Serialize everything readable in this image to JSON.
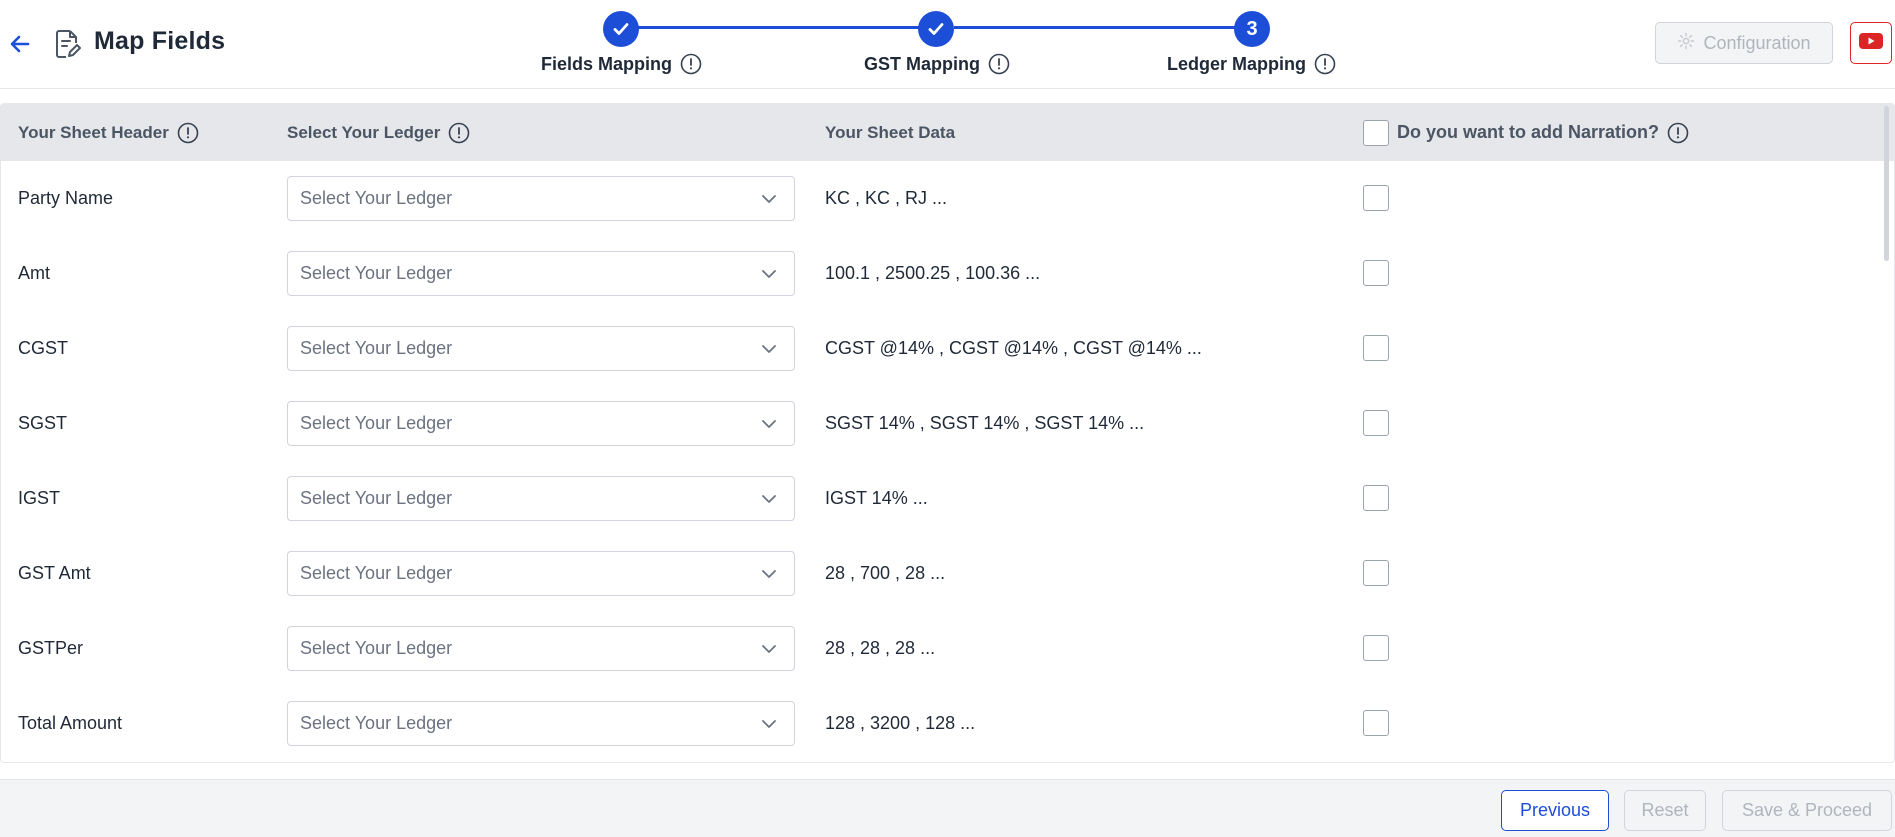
{
  "header": {
    "title": "Map Fields",
    "configuration_label": "Configuration"
  },
  "stepper": {
    "steps": [
      {
        "label": "Fields Mapping",
        "state": "completed",
        "marker": ""
      },
      {
        "label": "GST Mapping",
        "state": "completed",
        "marker": ""
      },
      {
        "label": "Ledger Mapping",
        "state": "active",
        "marker": "3"
      }
    ]
  },
  "table": {
    "columns": {
      "sheet_header": "Your Sheet Header",
      "select_ledger": "Select Your Ledger",
      "sheet_data": "Your Sheet Data",
      "narration": "Do you want to add Narration?"
    },
    "rows": [
      {
        "name": "Party Name",
        "select_placeholder": "Select Your Ledger",
        "data": "KC , KC , RJ ..."
      },
      {
        "name": "Amt",
        "select_placeholder": "Select Your Ledger",
        "data": "100.1 , 2500.25 , 100.36 ..."
      },
      {
        "name": "CGST",
        "select_placeholder": "Select Your Ledger",
        "data": "CGST @14% , CGST @14% , CGST @14% ..."
      },
      {
        "name": "SGST",
        "select_placeholder": "Select Your Ledger",
        "data": "SGST 14% , SGST 14% , SGST 14% ..."
      },
      {
        "name": "IGST",
        "select_placeholder": "Select Your Ledger",
        "data": "IGST 14% ..."
      },
      {
        "name": "GST Amt",
        "select_placeholder": "Select Your Ledger",
        "data": "28 , 700 , 28 ..."
      },
      {
        "name": "GSTPer",
        "select_placeholder": "Select Your Ledger",
        "data": "28 , 28 , 28 ..."
      },
      {
        "name": "Total Amount",
        "select_placeholder": "Select Your Ledger",
        "data": "128 , 3200 , 128 ..."
      }
    ]
  },
  "footer": {
    "previous_label": "Previous",
    "reset_label": "Reset",
    "save_label": "Save & Proceed"
  },
  "colors": {
    "primary": "#1d4ed8",
    "youtube_red": "#dc2626",
    "header_bg": "#e5e7eb"
  }
}
